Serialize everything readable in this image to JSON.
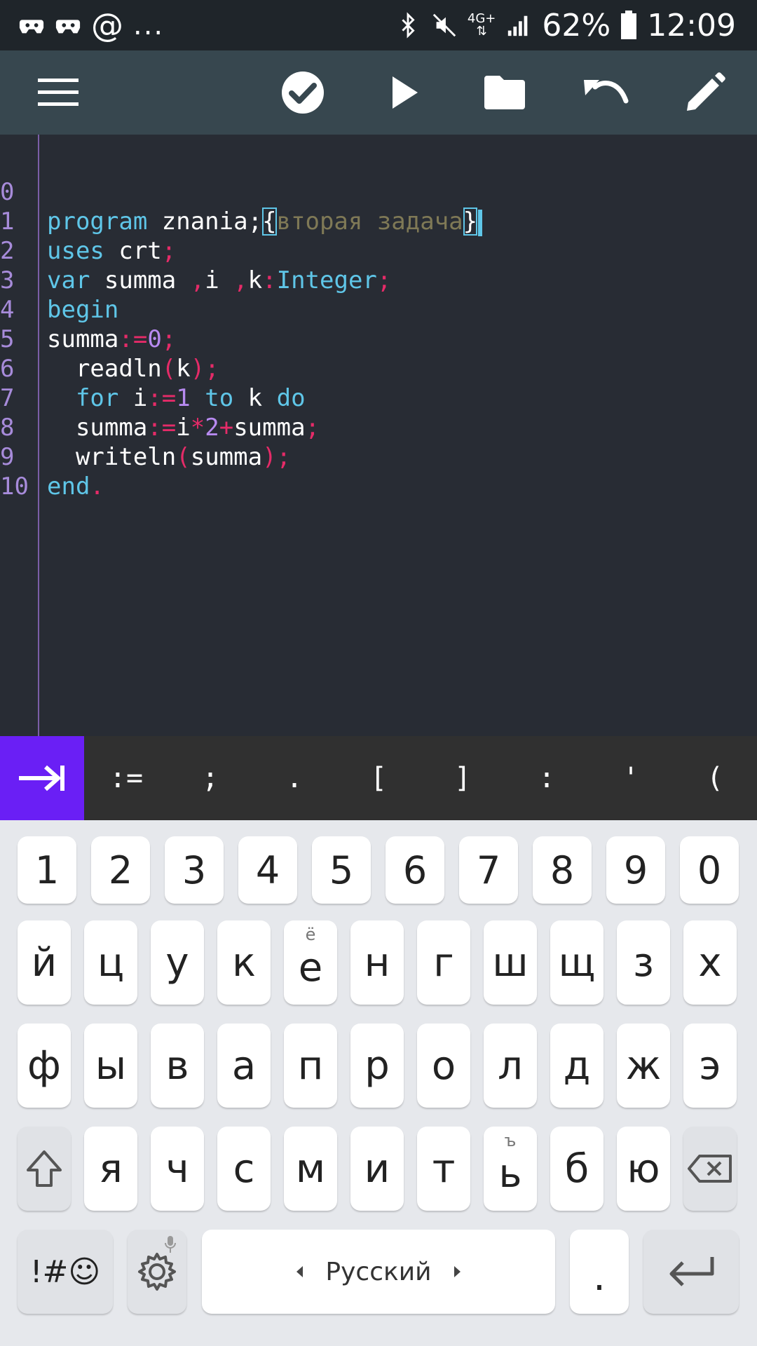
{
  "status_bar": {
    "at_symbol": "@",
    "more": "...",
    "network": "4G+",
    "battery": "62%",
    "time": "12:09"
  },
  "toolbar": {
    "icons": [
      "menu-icon",
      "check-icon",
      "play-icon",
      "folder-icon",
      "undo-icon",
      "pencil-icon"
    ]
  },
  "editor": {
    "line_numbers": [
      "0",
      "1",
      "2",
      "3",
      "4",
      "5",
      "6",
      "7",
      "8",
      "9",
      "10"
    ],
    "tokens": {
      "l0_kw": "program",
      "l0_name": " znania;",
      "l0_ob": "{",
      "l0_comment": "вторая задача",
      "l0_cb": "}",
      "l1_kw": "uses",
      "l1_name": " crt",
      "l1_semi": ";",
      "l2_kw": "var",
      "l2_a": " summa ",
      "l2_c1": ",",
      "l2_b": "i ",
      "l2_c2": ",",
      "l2_c": "k",
      "l2_colon": ":",
      "l2_type": "Integer",
      "l2_semi": ";",
      "l3_kw": "begin",
      "l4_a": "summa",
      "l4_op": ":=",
      "l4_num": "0",
      "l4_semi": ";",
      "l5_a": "  readln",
      "l5_op1": "(",
      "l5_b": "k",
      "l5_op2": ");",
      "l6_kw1": "  for",
      "l6_a": " i",
      "l6_op": ":=",
      "l6_num": "1",
      "l6_kw2": " to",
      "l6_b": " k ",
      "l6_kw3": "do",
      "l7_a": "  summa",
      "l7_op1": ":=",
      "l7_b": "i",
      "l7_op2": "*",
      "l7_num": "2",
      "l7_op3": "+",
      "l7_c": "summa",
      "l7_semi": ";",
      "l8_a": "  writeln",
      "l8_op1": "(",
      "l8_b": "summa",
      "l8_op2": ");",
      "l9_kw": "end",
      "l9_op": "."
    }
  },
  "symbols": [
    ":=",
    ";",
    ".",
    "[",
    "]",
    ":",
    "'",
    "("
  ],
  "keyboard": {
    "numbers": [
      "1",
      "2",
      "3",
      "4",
      "5",
      "6",
      "7",
      "8",
      "9",
      "0"
    ],
    "row1": [
      "й",
      "ц",
      "у",
      "к",
      "е",
      "н",
      "г",
      "ш",
      "щ",
      "з",
      "х"
    ],
    "row1_hint_e": "ё",
    "row2": [
      "ф",
      "ы",
      "в",
      "а",
      "п",
      "р",
      "о",
      "л",
      "д",
      "ж",
      "э"
    ],
    "row3": [
      "я",
      "ч",
      "с",
      "м",
      "и",
      "т",
      "ь",
      "б",
      "ю"
    ],
    "row3_hint_soft": "ъ",
    "symbols_key": "!#☺",
    "space_label": "Русский",
    "period_key": "."
  },
  "colors": {
    "accent_tab": "#6a1ff5",
    "toolbar": "#37474f",
    "keyword": "#5fc6e8",
    "operator": "#e52b68",
    "number": "#b78af0",
    "comment": "#7f7956"
  }
}
